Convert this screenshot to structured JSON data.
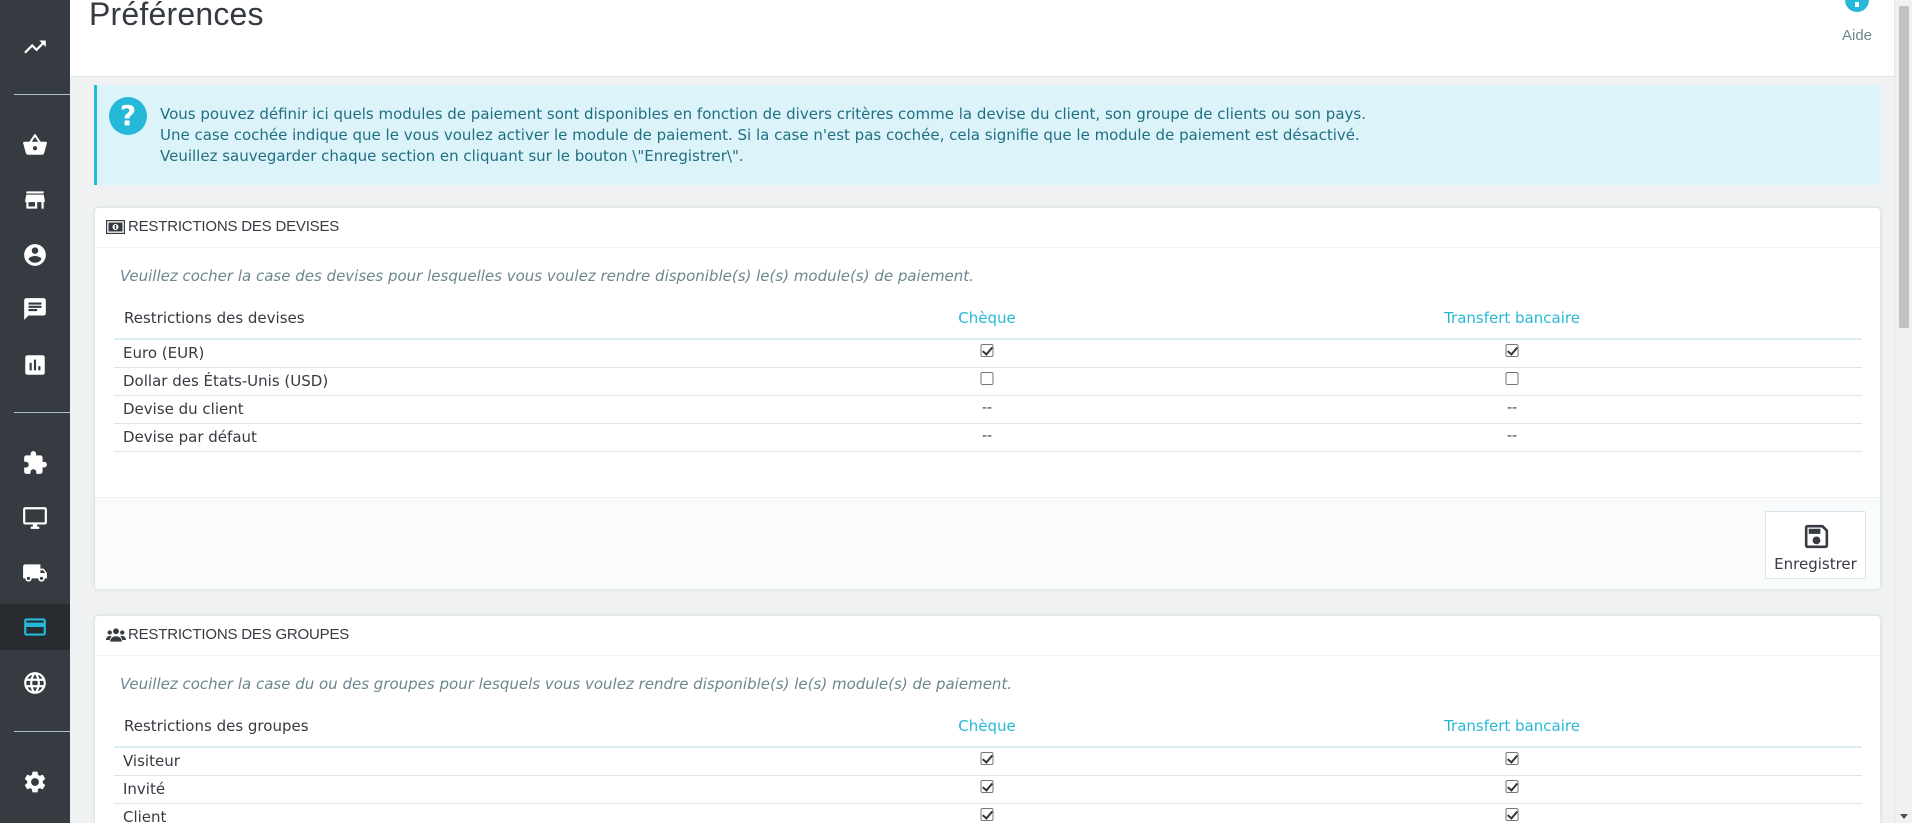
{
  "sidebar": {
    "items": [
      {
        "icon": "trending-up-icon",
        "name": "nav-dashboard"
      },
      {
        "icon": "basket-icon",
        "name": "nav-orders"
      },
      {
        "icon": "store-icon",
        "name": "nav-catalog"
      },
      {
        "icon": "account-icon",
        "name": "nav-customers"
      },
      {
        "icon": "chat-icon",
        "name": "nav-customer-service"
      },
      {
        "icon": "bar-chart-icon",
        "name": "nav-stats"
      },
      {
        "icon": "puzzle-icon",
        "name": "nav-modules"
      },
      {
        "icon": "monitor-icon",
        "name": "nav-design"
      },
      {
        "icon": "truck-icon",
        "name": "nav-shipping"
      },
      {
        "icon": "credit-card-icon",
        "name": "nav-payment",
        "active": true
      },
      {
        "icon": "globe-icon",
        "name": "nav-international"
      },
      {
        "icon": "gear-icon",
        "name": "nav-settings"
      }
    ],
    "active_color": "#25b9d7"
  },
  "header": {
    "title": "Préférences",
    "help_label": "Aide"
  },
  "alert": {
    "lines": [
      "Vous pouvez définir ici quels modules de paiement sont disponibles en fonction de divers critères comme la devise du client, son groupe de clients ou son pays.",
      "Une case cochée indique que le vous voulez activer le module de paiement. Si la case n'est pas cochée, cela signifie que le module de paiement est désactivé.",
      "Veuillez sauvegarder chaque section en cliquant sur le bouton \\\"Enregistrer\\\"."
    ]
  },
  "currency_panel": {
    "title": "RESTRICTIONS DES DEVISES",
    "description": "Veuillez cocher la case des devises pour lesquelles vous voulez rendre disponible(s) le(s) module(s) de paiement.",
    "columns": [
      "Restrictions des devises",
      "Chèque",
      "Transfert bancaire"
    ],
    "rows": [
      {
        "label": "Euro (EUR)",
        "cheque": "checked",
        "transfer": "checked"
      },
      {
        "label": "Dollar des États-Unis (USD)",
        "cheque": "unchecked",
        "transfer": "unchecked"
      },
      {
        "label": "Devise du client",
        "cheque": "--",
        "transfer": "--"
      },
      {
        "label": "Devise par défaut",
        "cheque": "--",
        "transfer": "--"
      }
    ],
    "save_label": "Enregistrer"
  },
  "group_panel": {
    "title": "RESTRICTIONS DES GROUPES",
    "description": "Veuillez cocher la case du ou des groupes pour lesquels vous voulez rendre disponible(s) le(s) module(s) de paiement.",
    "columns": [
      "Restrictions des groupes",
      "Chèque",
      "Transfert bancaire"
    ],
    "rows": [
      {
        "label": "Visiteur",
        "cheque": "checked",
        "transfer": "checked"
      },
      {
        "label": "Invité",
        "cheque": "checked",
        "transfer": "checked"
      },
      {
        "label": "Client",
        "cheque": "checked",
        "transfer": "checked"
      }
    ]
  }
}
